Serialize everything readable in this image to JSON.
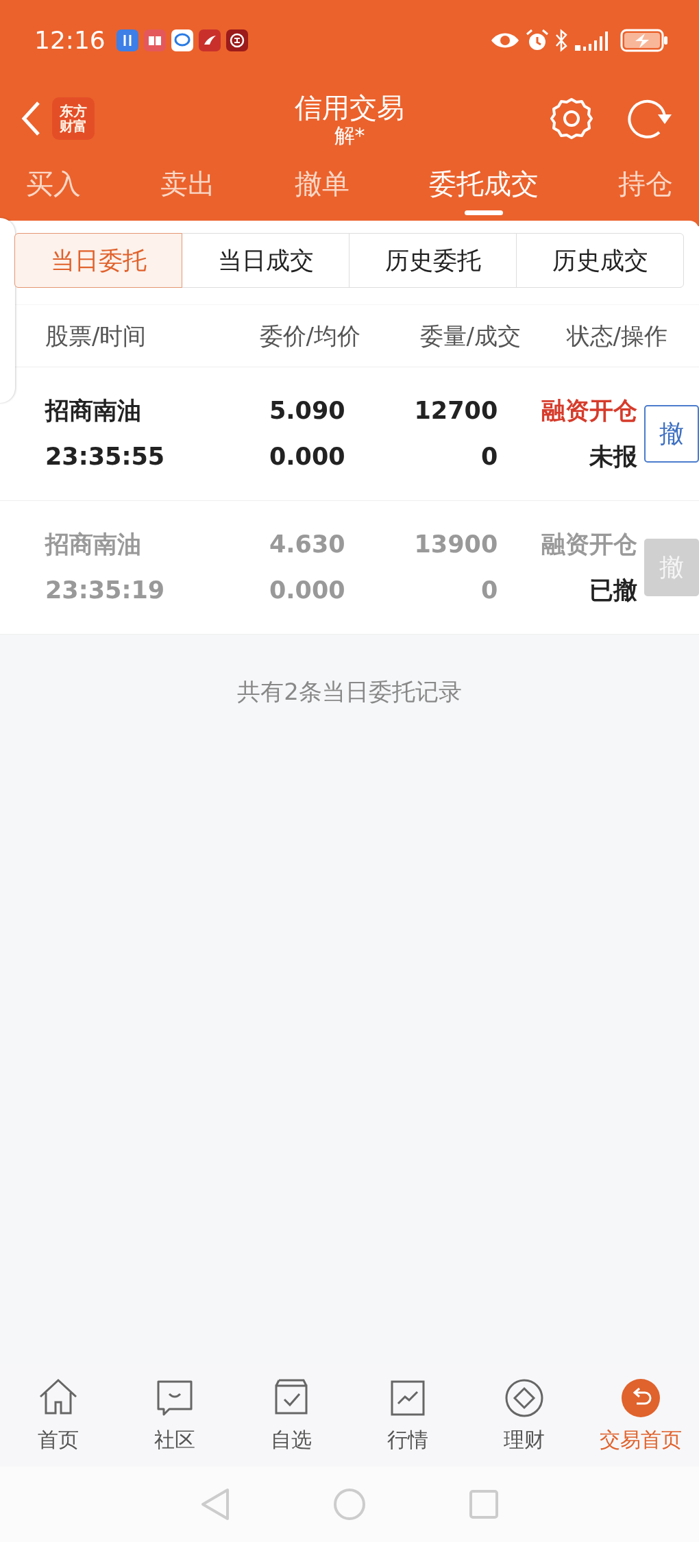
{
  "status_bar": {
    "time": "12:16"
  },
  "header": {
    "logo": [
      "东方",
      "财富"
    ],
    "title": "信用交易",
    "subtitle": "解*"
  },
  "tabs": [
    {
      "label": "买入",
      "selected": false
    },
    {
      "label": "卖出",
      "selected": false
    },
    {
      "label": "撤单",
      "selected": false
    },
    {
      "label": "委托成交",
      "selected": true
    },
    {
      "label": "持仓",
      "selected": false
    }
  ],
  "subtabs": [
    {
      "label": "当日委托",
      "selected": true
    },
    {
      "label": "当日成交",
      "selected": false
    },
    {
      "label": "历史委托",
      "selected": false
    },
    {
      "label": "历史成交",
      "selected": false
    }
  ],
  "table": {
    "columns": [
      "股票/时间",
      "委价/均价",
      "委量/成交",
      "状态/操作"
    ],
    "rows": [
      {
        "name": "招商南油",
        "time": "23:35:55",
        "price": "5.090",
        "avg_price": "0.000",
        "quantity": "12700",
        "filled": "0",
        "type": "融资开仓",
        "status": "未报",
        "action": "撤",
        "cancelable": true
      },
      {
        "name": "招商南油",
        "time": "23:35:19",
        "price": "4.630",
        "avg_price": "0.000",
        "quantity": "13900",
        "filled": "0",
        "type": "融资开仓",
        "status": "已撤",
        "action": "撤",
        "cancelable": false
      }
    ]
  },
  "summary": "共有2条当日委托记录",
  "bottom_nav": [
    {
      "label": "首页",
      "selected": false
    },
    {
      "label": "社区",
      "selected": false
    },
    {
      "label": "自选",
      "selected": false
    },
    {
      "label": "行情",
      "selected": false
    },
    {
      "label": "理财",
      "selected": false
    },
    {
      "label": "交易首页",
      "selected": true
    }
  ]
}
